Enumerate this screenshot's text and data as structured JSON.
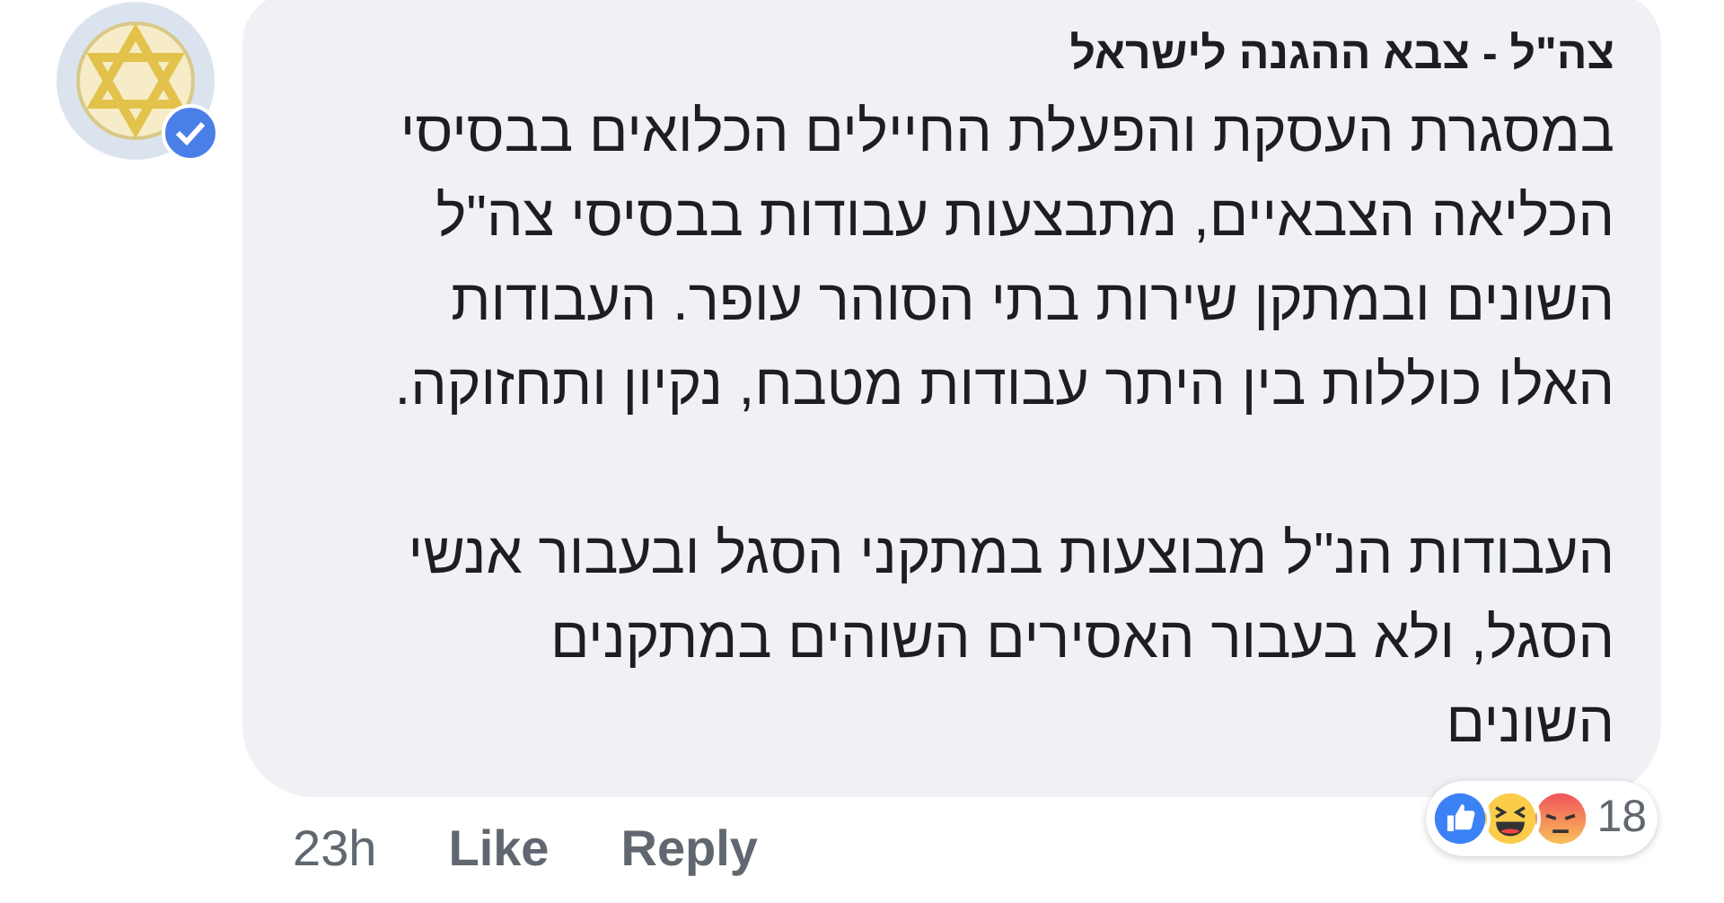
{
  "comment": {
    "author": "צה\"ל - צבא ההגנה לישראל",
    "verified": true,
    "paragraphs": [
      "במסגרת העסקת והפעלת החיילים הכלואים בבסיסי הכליאה הצבאיים, מתבצעות עבודות בבסיסי צה\"ל השונים ובמתקן שירות בתי הסוהר עופר. העבודות האלו כוללות בין היתר עבודות מטבח, נקיון ותחזוקה.",
      "העבודות הנ\"ל מבוצעות במתקני הסגל ובעבור אנשי הסגל, ולא בעבור האסירים השוהים במתקנים השונים"
    ],
    "time": "23h",
    "like": "Like",
    "reply": "Reply",
    "reactions": {
      "icons": [
        {
          "kind": "like"
        },
        {
          "kind": "haha"
        },
        {
          "kind": "angry"
        }
      ],
      "count": "18"
    }
  }
}
